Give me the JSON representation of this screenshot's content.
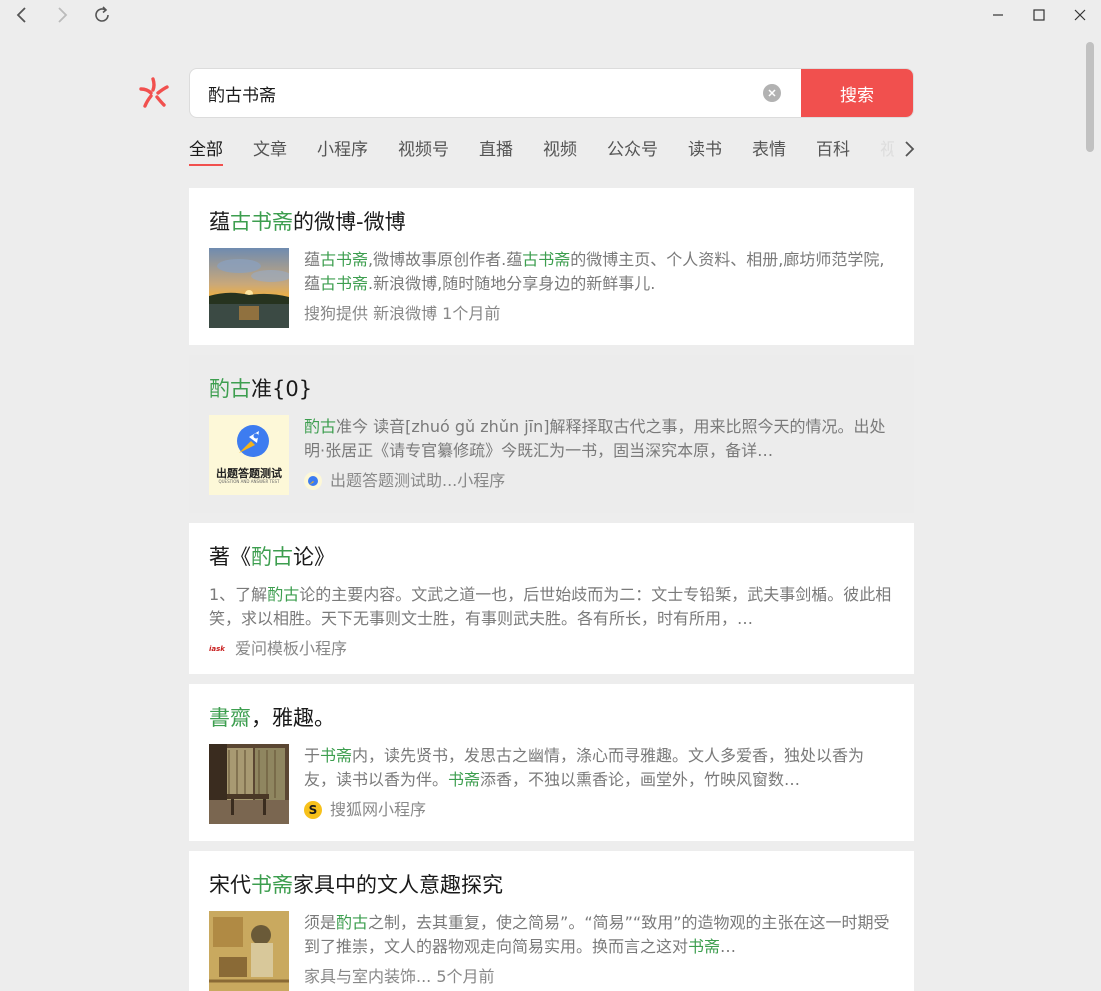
{
  "search": {
    "query": "酌古书斋",
    "button_label": "搜索"
  },
  "tabs": [
    "全部",
    "文章",
    "小程序",
    "视频号",
    "直播",
    "视频",
    "公众号",
    "读书",
    "表情",
    "百科",
    "视"
  ],
  "results": [
    {
      "title": [
        {
          "t": "蕴",
          "h": false
        },
        {
          "t": "古书斋",
          "h": true
        },
        {
          "t": "的微博-微博",
          "h": false
        }
      ],
      "desc": [
        {
          "t": "蕴",
          "h": false
        },
        {
          "t": "古书斋",
          "h": true
        },
        {
          "t": ",微博故事原创作者.蕴",
          "h": false
        },
        {
          "t": "古书斋",
          "h": true
        },
        {
          "t": "的微博主页、个人资料、相册,廊坊师范学院,蕴",
          "h": false
        },
        {
          "t": "古书斋",
          "h": true
        },
        {
          "t": ".新浪微博,随时随地分享身边的新鲜事儿.",
          "h": false
        }
      ],
      "source": "搜狗提供 新浪微博  1个月前",
      "thumbnail": "sunset-lake-image",
      "source_icon": ""
    },
    {
      "title": [
        {
          "t": "酌古",
          "h": true
        },
        {
          "t": "准{0}",
          "h": false
        }
      ],
      "desc": [
        {
          "t": "酌古",
          "h": true
        },
        {
          "t": "准今 读音[zhuó gǔ zhǔn jīn]解释择取古代之事，用来比照今天的情况。出处明·张居正《请专官纂修疏》今既汇为一书，固当深究本原，备详…",
          "h": false
        }
      ],
      "source": "出题答题测试助...小程序",
      "thumbnail": "quiz-rocket-image",
      "thumbnail_caption": "出题答题测试",
      "thumbnail_subcaption": "QUESTION AND ANSWER TEST",
      "source_icon": "quiz-app-icon"
    },
    {
      "title": [
        {
          "t": "著《",
          "h": false
        },
        {
          "t": "酌古",
          "h": true
        },
        {
          "t": "论》",
          "h": false
        }
      ],
      "desc": [
        {
          "t": "1、了解",
          "h": false
        },
        {
          "t": "酌古",
          "h": true
        },
        {
          "t": "论的主要内容。文武之道一也，后世始歧而为二：文士专铅椠，武夫事剑楯。彼此相笑，求以相胜。天下无事则文士胜，有事则武夫胜。各有所长，时有所用，…",
          "h": false
        }
      ],
      "source": "爱问模板小程序",
      "source_icon": "iask-icon",
      "source_icon_text": "iask"
    },
    {
      "title": [
        {
          "t": "書齋",
          "h": true
        },
        {
          "t": "，雅趣。",
          "h": false
        }
      ],
      "desc": [
        {
          "t": "于",
          "h": false
        },
        {
          "t": "书斋",
          "h": true
        },
        {
          "t": "内，读先贤书，发思古之幽情，涤心而寻雅趣。文人多爱香，独处以香为友，读书以香为伴。",
          "h": false
        },
        {
          "t": "书斋",
          "h": true
        },
        {
          "t": "添香，不独以熏香论，画堂外，竹映风窗数…",
          "h": false
        }
      ],
      "source": "搜狐网小程序",
      "thumbnail": "study-room-image",
      "source_icon": "sohu-icon",
      "source_icon_text": "S"
    },
    {
      "title": [
        {
          "t": "宋代",
          "h": false
        },
        {
          "t": "书斋",
          "h": true
        },
        {
          "t": "家具中的文人意趣探究",
          "h": false
        }
      ],
      "desc": [
        {
          "t": "须是",
          "h": false
        },
        {
          "t": "酌古",
          "h": true
        },
        {
          "t": "之制，去其重复，使之简易”。“简易”“致用”的造物观的主张在这一时期受到了推崇，文人的器物观走向简易实用。换而言之这对",
          "h": false
        },
        {
          "t": "书斋",
          "h": true
        },
        {
          "t": "…",
          "h": false
        }
      ],
      "source": "家具与室内装饰...  5个月前",
      "thumbnail": "song-painting-image",
      "source_icon": ""
    }
  ],
  "colors": {
    "accent": "#f1504e",
    "highlight": "#3d9e4f"
  }
}
